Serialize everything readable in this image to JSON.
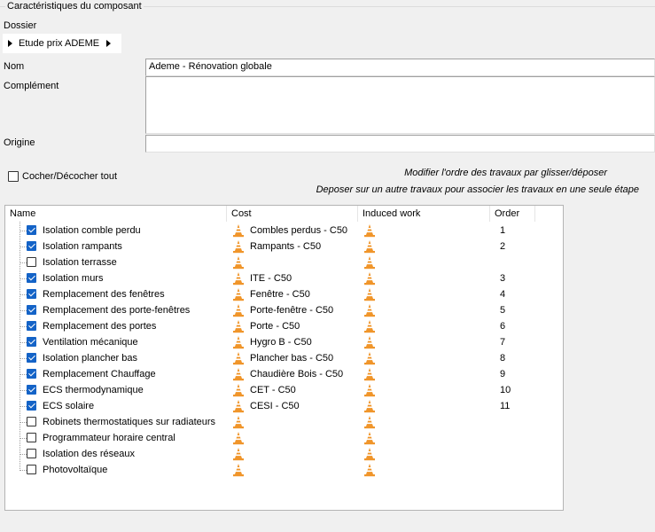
{
  "group_title": "Caractéristiques du composant",
  "dossier": {
    "label": "Dossier",
    "path": "Etude prix ADEME"
  },
  "fields": {
    "nom_label": "Nom",
    "nom_value": "Ademe - Rénovation globale",
    "complement_label": "Complément",
    "complement_value": "",
    "origine_label": "Origine",
    "origine_value": ""
  },
  "check_all_label": "Cocher/Décocher tout",
  "hints": {
    "reorder": "Modifier l'ordre des travaux par glisser/déposer",
    "associate": "Deposer sur un autre travaux pour associer les travaux en une seule étape"
  },
  "columns": {
    "name": "Name",
    "cost": "Cost",
    "induced": "Induced work",
    "order": "Order"
  },
  "rows": [
    {
      "name": "Isolation comble perdu",
      "checked": true,
      "cost": "Combles perdus - C50",
      "order": "1"
    },
    {
      "name": "Isolation rampants",
      "checked": true,
      "cost": "Rampants - C50",
      "order": "2"
    },
    {
      "name": "Isolation terrasse",
      "checked": false,
      "cost": "",
      "order": ""
    },
    {
      "name": "Isolation murs",
      "checked": true,
      "cost": "ITE - C50",
      "order": "3"
    },
    {
      "name": "Remplacement des fenêtres",
      "checked": true,
      "cost": "Fenêtre - C50",
      "order": "4"
    },
    {
      "name": "Remplacement des porte-fenêtres",
      "checked": true,
      "cost": "Porte-fenêtre - C50",
      "order": "5"
    },
    {
      "name": "Remplacement des portes",
      "checked": true,
      "cost": "Porte - C50",
      "order": "6"
    },
    {
      "name": "Ventilation mécanique",
      "checked": true,
      "cost": "Hygro B - C50",
      "order": "7"
    },
    {
      "name": "Isolation plancher bas",
      "checked": true,
      "cost": "Plancher bas - C50",
      "order": "8"
    },
    {
      "name": "Remplacement Chauffage",
      "checked": true,
      "cost": "Chaudière Bois - C50",
      "order": "9"
    },
    {
      "name": "ECS thermodynamique",
      "checked": true,
      "cost": "CET - C50",
      "order": "10"
    },
    {
      "name": "ECS solaire",
      "checked": true,
      "cost": "CESI - C50",
      "order": "11"
    },
    {
      "name": "Robinets thermostatiques sur radiateurs",
      "checked": false,
      "cost": "",
      "order": ""
    },
    {
      "name": "Programmateur horaire central",
      "checked": false,
      "cost": "",
      "order": ""
    },
    {
      "name": "Isolation des réseaux",
      "checked": false,
      "cost": "",
      "order": ""
    },
    {
      "name": "Photovoltaïque",
      "checked": false,
      "cost": "",
      "order": ""
    }
  ],
  "icons": {
    "cost_icon": "traffic-cone-icon",
    "induced_icon": "traffic-cone-icon"
  },
  "colors": {
    "checkbox_on": "#1463c7",
    "cone_orange": "#f0952a"
  }
}
